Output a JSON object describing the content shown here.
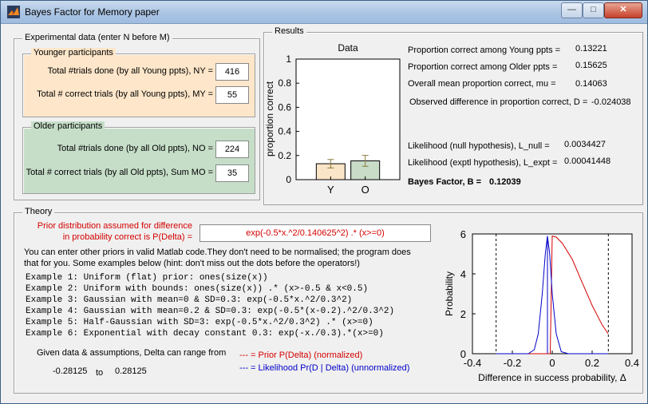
{
  "window": {
    "title": "Bayes Factor for Memory paper"
  },
  "experimental": {
    "title": "Experimental data (enter N before M)",
    "younger": {
      "title": "Younger participants",
      "ny_label": "Total #trials done (by all Young ppts), NY =",
      "ny_value": "416",
      "my_label": "Total # correct trials (by all Young ppts), MY =",
      "my_value": "55"
    },
    "older": {
      "title": "Older participants",
      "no_label": "Total #trials done (by all Old ppts), NO =",
      "no_value": "224",
      "mo_label": "Total # correct trials (by all Old ppts), Sum MO =",
      "mo_value": "35"
    }
  },
  "results": {
    "title": "Results",
    "young_label": "Proportion correct among Young ppts =",
    "young_value": "0.13221",
    "older_label": "Proportion correct among Older ppts =",
    "older_value": "0.15625",
    "mu_label": "Overall mean proportion correct, mu =",
    "mu_value": "0.14063",
    "diff_label": "Observed difference in proportion correct, D =",
    "diff_value": "-0.024038",
    "lnull_label": "Likelihood (null hypothesis), L_null =",
    "lnull_value": "0.0034427",
    "lexpt_label": "Likelihood (exptl hypothesis), L_expt =",
    "lexpt_value": "0.00041448",
    "bf_label": "Bayes Factor, B =",
    "bf_value": "0.12039"
  },
  "theory": {
    "title": "Theory",
    "prior_label_1": "Prior distribution assumed for difference",
    "prior_label_2": "in probability correct is P(Delta) =",
    "prior_expr": "exp(-0.5*x.^2/0.140625^2) .* (x>=0)",
    "help_1": "You can enter other priors in valid Matlab code.They don't need to be normalised; the program does",
    "help_2": "that for you. Some examples below (hint: don't miss out the dots before the operators!)",
    "examples": [
      "Example 1: Uniform (flat) prior:  ones(size(x))",
      "Example 2: Uniform with bounds: ones(size(x)) .* (x>-0.5 & x<0.5)",
      "Example 3: Gaussian with mean=0 & SD=0.3: exp(-0.5*x.^2/0.3^2)",
      "Example 4: Gaussian with mean=0.2 & SD=0.3: exp(-0.5*(x-0.2).^2/0.3^2)",
      "Example 5: Half-Gaussian with SD=3: exp(-0.5*x.^2/0.3^2) .* (x>=0)",
      "Example 6: Exponential with decay constant 0.3: exp(-x./0.3).*(x>=0)"
    ],
    "range_label": "Given data & assumptions, Delta can range from",
    "range_min": "-0.28125",
    "range_to": "to",
    "range_max": "0.28125",
    "legend_prior": "--- = Prior P(Delta) (normalized)",
    "legend_likelihood": "--- = Likelihood Pr(D | Delta) (unnormalized)"
  },
  "colors": {
    "prior": "#d40000",
    "likelihood": "#0000c8",
    "young_bar": "#fbe5c8",
    "old_bar": "#c8dcc8",
    "younger_panel": "#fde6c9",
    "older_panel": "#c6dec8"
  },
  "chart_data": [
    {
      "type": "bar",
      "title": "Data",
      "ylabel": "proportion correct",
      "categories": [
        "Y",
        "O"
      ],
      "values": [
        0.132,
        0.156
      ],
      "errors": [
        0.035,
        0.045
      ],
      "ylim": [
        0,
        1
      ],
      "yticks": [
        "0",
        "0.2",
        "0.4",
        "0.6",
        "0.8",
        "1"
      ]
    },
    {
      "type": "line",
      "xlabel": "Difference in success probability, Δ",
      "ylabel": "Probability",
      "xlim": [
        -0.4,
        0.4
      ],
      "ylim": [
        0,
        6
      ],
      "xticks": [
        "-0.4",
        "-0.2",
        "0",
        "0.2",
        "0.4"
      ],
      "yticks": [
        "0",
        "2",
        "4",
        "6"
      ],
      "range_lines": [
        -0.28125,
        0.28125
      ],
      "observed_difference": -0.024038,
      "series": [
        {
          "name": "Prior P(Delta)",
          "x": [
            -0.28,
            -0.01,
            0.0,
            0.02,
            0.05,
            0.1,
            0.15,
            0.2,
            0.25,
            0.28
          ],
          "y": [
            0.0,
            0.0,
            5.9,
            5.84,
            5.54,
            4.74,
            3.57,
            2.42,
            1.45,
            1.0
          ]
        },
        {
          "name": "Likelihood Pr(D | Delta)",
          "x": [
            -0.28,
            -0.12,
            -0.09,
            -0.07,
            -0.05,
            -0.035,
            -0.024,
            -0.013,
            0.0,
            0.02,
            0.045,
            0.08,
            0.28
          ],
          "y": [
            0.0,
            0.0,
            0.2,
            1.0,
            3.0,
            5.0,
            5.9,
            5.0,
            3.0,
            1.0,
            0.1,
            0.0,
            0.0
          ]
        }
      ]
    }
  ]
}
